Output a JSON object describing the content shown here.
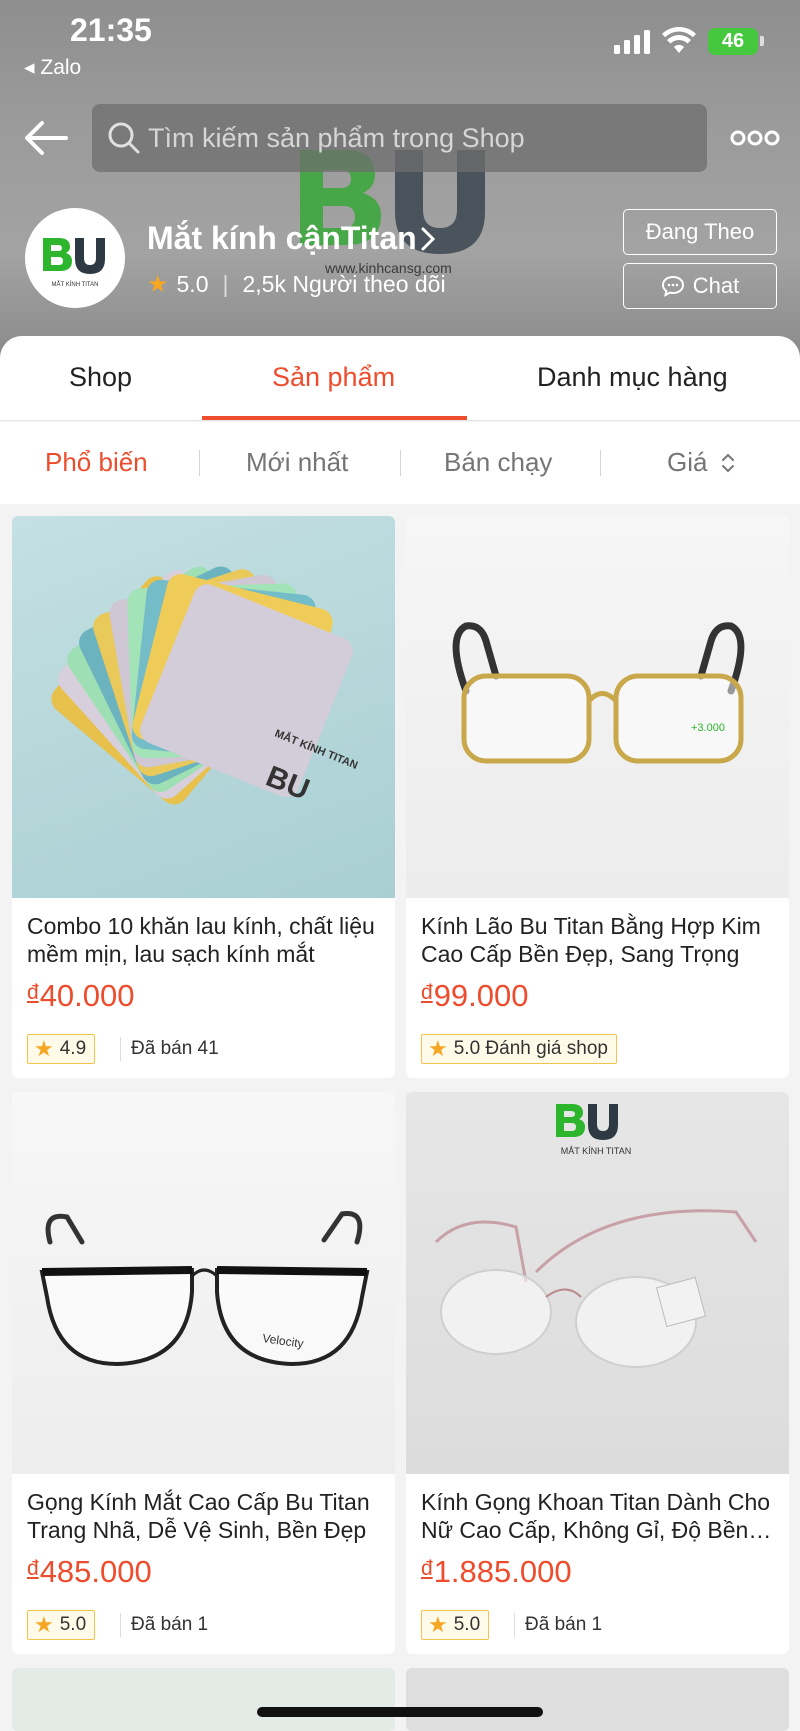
{
  "status_bar": {
    "time": "21:35",
    "back_app": "◂ Zalo",
    "battery": "46"
  },
  "header": {
    "search_placeholder": "Tìm kiếm sản phẩm trong Shop",
    "bg_url": "www.kinhcansg.com",
    "shop_name": "Mắt kính cậnTitan",
    "rating": "5.0",
    "followers": "2,5k Người theo dõi",
    "follow_label": "Đang Theo",
    "chat_label": "Chat",
    "logo_caption": "MẮT KÍNH TITAN"
  },
  "tabs": [
    {
      "label": "Shop"
    },
    {
      "label": "Sản phẩm",
      "active": true
    },
    {
      "label": "Danh mục hàng"
    }
  ],
  "sort": [
    {
      "label": "Phổ biến",
      "active": true
    },
    {
      "label": "Mới nhất"
    },
    {
      "label": "Bán chạy"
    },
    {
      "label": "Giá"
    }
  ],
  "products": [
    {
      "title": "Combo 10 khăn lau kính, chất liệu mềm mịn, lau sạch kính mắt",
      "currency": "đ",
      "price": "40.000",
      "rating": "4.9",
      "sold": "Đã bán 41",
      "image_text": "MẮT KÍNH TITAN"
    },
    {
      "title": "Kính Lão Bu Titan Bằng Hợp Kim Cao Cấp Bền Đẹp, Sang Trọng",
      "currency": "đ",
      "price": "99.000",
      "rating": "5.0 Đánh giá shop",
      "sold": "",
      "image_text": "+3.000"
    },
    {
      "title": "Gọng Kính Mắt Cao Cấp Bu Titan Trang Nhã, Dễ Vệ Sinh, Bền Đẹp",
      "currency": "đ",
      "price": "485.000",
      "rating": "5.0",
      "sold": "Đã bán 1",
      "image_text": "Velocity"
    },
    {
      "title": "Kính Gọng Khoan Titan Dành Cho Nữ Cao Cấp, Không Gỉ, Độ Bền Cao",
      "currency": "đ",
      "price": "1.885.000",
      "rating": "5.0",
      "sold": "Đã bán 1",
      "image_text": "MẮT KÍNH TITAN"
    }
  ],
  "colors": {
    "accent": "#ee4d2d",
    "star": "#f5a623",
    "brand_green": "#2db52d"
  }
}
